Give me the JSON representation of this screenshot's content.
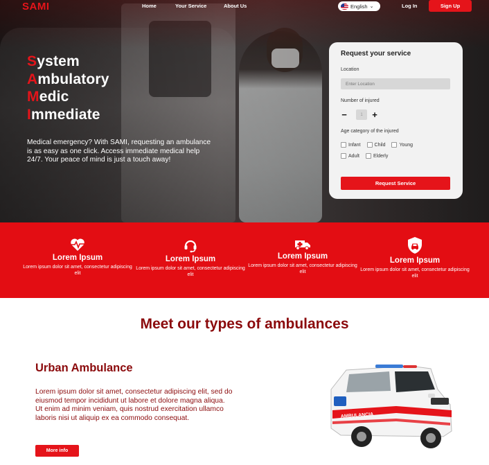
{
  "nav": {
    "logo": "SAMI",
    "links": [
      "Home",
      "Your Service",
      "About Us"
    ],
    "language": "English",
    "login": "Log In",
    "signup": "Sign Up"
  },
  "hero": {
    "acronym": [
      {
        "first": "S",
        "rest": "ystem"
      },
      {
        "first": "A",
        "rest": "mbulatory"
      },
      {
        "first": "M",
        "rest": "edic"
      },
      {
        "first": "I",
        "rest": "mmediate"
      }
    ],
    "description": "Medical emergency? With SAMI, requesting an ambulance is as easy as one click. Access immediate medical help 24/7. Your peace of mind is just a touch away!"
  },
  "form": {
    "title": "Request your service",
    "location_label": "Location",
    "location_placeholder": "Enter Location",
    "injured_label": "Number of injured",
    "injured_value": "1",
    "minus": "−",
    "plus": "+",
    "age_label": "Age category of the injured",
    "age_row1": [
      "Infant",
      "Child",
      "Young"
    ],
    "age_row2": [
      "Adult",
      "Elderly"
    ],
    "submit": "Request Service"
  },
  "features": [
    {
      "icon": "heartbeat-icon",
      "title": "Lorem Ipsum",
      "desc": "Lorem ipsum dolor sit amet, consectetur adipiscing elit"
    },
    {
      "icon": "headset-icon",
      "title": "Lorem Ipsum",
      "desc": "Lorem ipsum dolor sit amet, consectetur adipiscing elit"
    },
    {
      "icon": "ambulance-icon",
      "title": "Lorem Ipsum",
      "desc": "Lorem ipsum dolor sit amet, consectetur adipiscing elit"
    },
    {
      "icon": "shield-car-icon",
      "title": "Lorem Ipsum",
      "desc": "Lorem ipsum dolor sit amet, consectetur adipiscing elit"
    }
  ],
  "ambulances": {
    "section_title": "Meet our types of ambulances",
    "item_title": "Urban Ambulance",
    "item_desc": "Lorem ipsum dolor sit amet, consectetur adipiscing elit, sed do eiusmod tempor incididunt ut labore et dolore magna aliqua. Ut enim ad minim veniam, quis nostrud exercitation ullamco laboris nisi ut aliquip ex ea commodo consequat.",
    "more_button": "More info",
    "vehicle_lettering": "AMBULANCIA"
  },
  "colors": {
    "accent": "#e5141a",
    "band": "#e30d13",
    "dark_red": "#8b0a0c"
  }
}
